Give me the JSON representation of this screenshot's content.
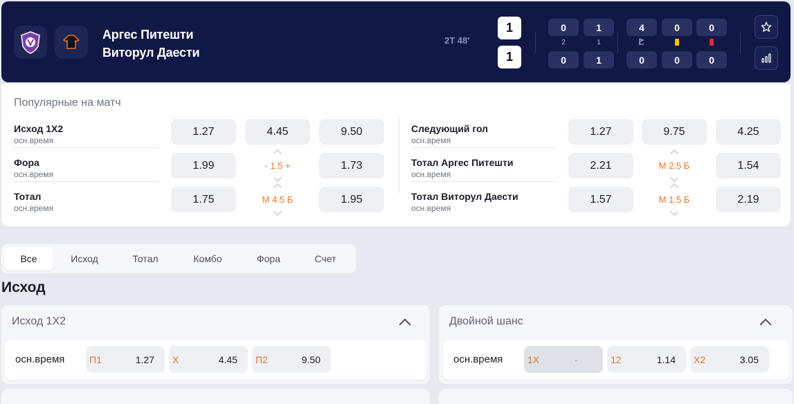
{
  "match": {
    "team_home": "Аргес Питешти",
    "team_away": "Виторул Даести",
    "time": "2Т 48'",
    "score_home": "1",
    "score_away": "1",
    "stats": [
      {
        "top": "0",
        "mid": "2",
        "bot": "0"
      },
      {
        "top": "1",
        "mid": "1",
        "bot": "1"
      },
      {
        "top": "4",
        "mid_icon": "corner-flag-icon",
        "bot": "0"
      },
      {
        "top": "0",
        "mid_icon": "yellow-card-icon",
        "bot": "0"
      },
      {
        "top": "0",
        "mid_icon": "red-card-icon",
        "bot": "0"
      }
    ]
  },
  "popular": {
    "title": "Популярные на матч",
    "left": [
      {
        "label": "Исход 1X2",
        "sub": "осн.время",
        "odds": [
          "1.27",
          "4.45",
          "9.50"
        ]
      },
      {
        "label": "Фора",
        "sub": "осн.время",
        "odds": [
          "1.99",
          "- 1.5 +",
          "1.73"
        ]
      },
      {
        "label": "Тотал",
        "sub": "осн.время",
        "odds": [
          "1.75",
          "М 4.5 Б",
          "1.95"
        ]
      }
    ],
    "right": [
      {
        "label": "Следующий гол",
        "sub": "осн.время",
        "odds": [
          "1.27",
          "9.75",
          "4.25"
        ]
      },
      {
        "label": "Тотал Аргес Питешти",
        "sub": "осн.время",
        "odds": [
          "2.21",
          "М 2.5 Б",
          "1.54"
        ]
      },
      {
        "label": "Тотал Виторул Даести",
        "sub": "осн.время",
        "odds": [
          "1.57",
          "М 1.5 Б",
          "2.19"
        ]
      }
    ]
  },
  "tabs": [
    "Все",
    "Исход",
    "Тотал",
    "Комбо",
    "Фора",
    "Счет"
  ],
  "section_title": "Исход",
  "markets": [
    {
      "title": "Исход 1X2",
      "row_label": "осн.время",
      "selections": [
        {
          "k": "П1",
          "v": "1.27"
        },
        {
          "k": "X",
          "v": "4.45"
        },
        {
          "k": "П2",
          "v": "9.50"
        }
      ]
    },
    {
      "title": "Двойной шанс",
      "row_label": "осн.время",
      "selections": [
        {
          "k": "1X",
          "v": "-"
        },
        {
          "k": "12",
          "v": "1.14"
        },
        {
          "k": "X2",
          "v": "3.05"
        }
      ]
    }
  ],
  "colors": {
    "header_bg": "#111846",
    "accent_orange": "#e8722a",
    "page_bg": "#e6e9f0"
  }
}
